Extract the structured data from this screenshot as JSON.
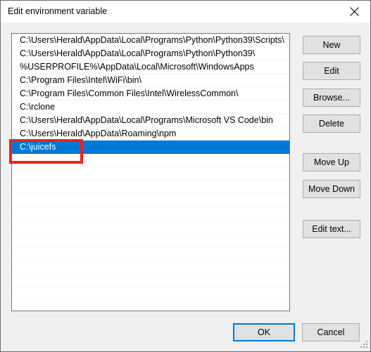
{
  "window": {
    "title": "Edit environment variable",
    "close_icon": "close-icon"
  },
  "listbox": {
    "items": [
      "C:\\Users\\Herald\\AppData\\Local\\Programs\\Python\\Python39\\Scripts\\",
      "C:\\Users\\Herald\\AppData\\Local\\Programs\\Python\\Python39\\",
      "%USERPROFILE%\\AppData\\Local\\Microsoft\\WindowsApps",
      "C:\\Program Files\\Intel\\WiFi\\bin\\",
      "C:\\Program Files\\Common Files\\Intel\\WirelessCommon\\",
      "C:\\rclone",
      "C:\\Users\\Herald\\AppData\\Local\\Programs\\Microsoft VS Code\\bin",
      "C:\\Users\\Herald\\AppData\\Roaming\\npm",
      "C:\\juicefs"
    ],
    "selected_index": 8,
    "empty_row_count": 11,
    "selection_color": "#0078d7"
  },
  "side_buttons": {
    "new": "New",
    "edit": "Edit",
    "browse": "Browse...",
    "delete": "Delete",
    "move_up": "Move Up",
    "move_down": "Move Down",
    "edit_text": "Edit text..."
  },
  "footer_buttons": {
    "ok": "OK",
    "cancel": "Cancel",
    "focus_color": "#0078d7"
  },
  "annotation": {
    "color": "#e8241c",
    "target": "C:\\juicefs"
  }
}
